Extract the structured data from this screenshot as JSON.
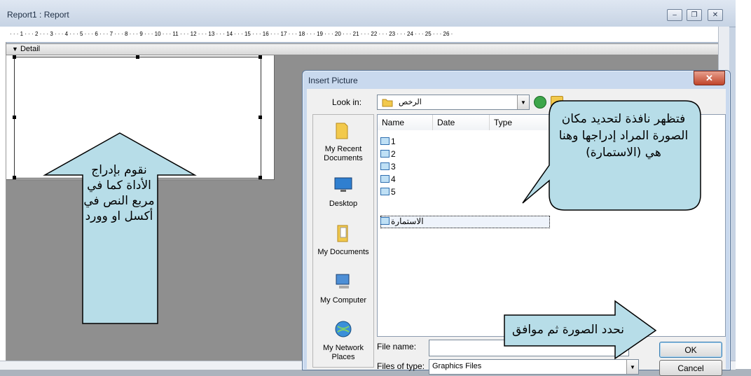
{
  "report": {
    "title": "Report1 : Report",
    "ruler_marks": "· · · 1 · · · 2 · · · 3 · · · 4 · · · 5 · · · 6 · · · 7 · · · 8 · · · 9 · · · 10 · · · 11 · · · 12 · · · 13 · · · 14 · · · 15 · · · 16 · · · 17 · · · 18 · · · 19 · · · 20 · · · 21 · · · 22 · · · 23 · · · 24 · · · 25 · · · 26 ·",
    "detail_label": "Detail",
    "window_buttons": {
      "minimize": "–",
      "restore": "❐",
      "close": "✕"
    }
  },
  "dialog": {
    "title": "Insert Picture",
    "close_glyph": "✕",
    "look_in_label": "Look in:",
    "look_in_value": "الرخص",
    "places": [
      {
        "label": "My Recent Documents",
        "icon": "recent-folder-icon"
      },
      {
        "label": "Desktop",
        "icon": "desktop-icon"
      },
      {
        "label": "My Documents",
        "icon": "my-documents-icon"
      },
      {
        "label": "My Computer",
        "icon": "my-computer-icon"
      },
      {
        "label": "My Network Places",
        "icon": "network-places-icon"
      }
    ],
    "columns": [
      "Name",
      "Date",
      "Type"
    ],
    "files": [
      "1",
      "2",
      "3",
      "4",
      "5",
      "الاستمارة"
    ],
    "file_name_label": "File name:",
    "file_name_value": "",
    "file_type_label": "Files of type:",
    "file_type_value": "Graphics Files",
    "ok_label": "OK",
    "cancel_label": "Cancel"
  },
  "callouts": {
    "up_arrow": "نقوم بإدراج الأداة كما في مربع النص في أكسل او وورد",
    "bubble": "فتظهر نافذة لتحديد مكان الصورة المراد إدراجها وهنا هي (الاستمارة)",
    "right_arrow": "نحدد الصورة ثم موافق"
  },
  "colors": {
    "callout_fill": "#b7dde8",
    "callout_stroke": "#000000"
  }
}
